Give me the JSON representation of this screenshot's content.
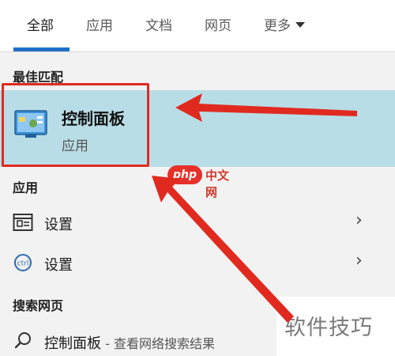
{
  "tabs": [
    {
      "label": "全部",
      "active": true
    },
    {
      "label": "应用",
      "active": false
    },
    {
      "label": "文档",
      "active": false
    },
    {
      "label": "网页",
      "active": false
    },
    {
      "label": "更多",
      "active": false
    }
  ],
  "best_match": {
    "header": "最佳匹配",
    "title": "控制面板",
    "subtitle": "应用",
    "icon": "control-panel-icon"
  },
  "apps": {
    "header": "应用",
    "items": [
      {
        "label": "设置",
        "icon": "settings-window-icon",
        "chevron": "›"
      },
      {
        "label": "设置",
        "icon": "settings-gear-icon",
        "chevron": "›"
      }
    ]
  },
  "web_search": {
    "header": "搜索网页",
    "query": "控制面板",
    "hint": " - 查看网络搜索结果",
    "icon": "search-icon"
  },
  "watermarks": {
    "php_badge": "php",
    "php_text": "中文网",
    "tips": "软件技巧"
  },
  "colors": {
    "accent": "#1e6fc6",
    "highlight": "#b9dde6",
    "annotation_red": "#e12a1f"
  }
}
